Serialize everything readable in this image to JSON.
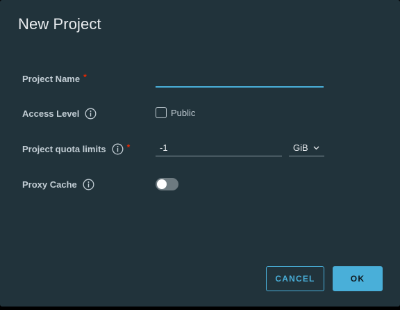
{
  "dialog": {
    "title": "New Project"
  },
  "form": {
    "project_name": {
      "label": "Project Name",
      "required_mark": "*",
      "value": ""
    },
    "access_level": {
      "label": "Access Level",
      "checkbox_label": "Public",
      "checked": false,
      "info_icon": "info-icon"
    },
    "quota": {
      "label": "Project quota limits",
      "required_mark": "*",
      "value": "-1",
      "unit": "GiB",
      "info_icon": "info-icon"
    },
    "proxy_cache": {
      "label": "Proxy Cache",
      "enabled": false,
      "info_icon": "info-icon"
    }
  },
  "buttons": {
    "cancel": "CANCEL",
    "ok": "OK"
  },
  "colors": {
    "background": "#21333b",
    "accent": "#49afd9",
    "required": "#e62700",
    "label": "#c2cdd4"
  }
}
